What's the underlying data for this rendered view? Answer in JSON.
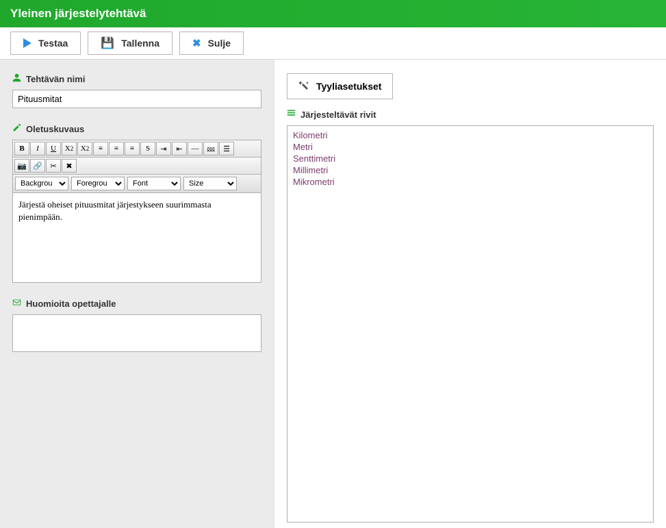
{
  "header": {
    "title": "Yleinen järjestelytehtävä"
  },
  "toolbar": {
    "test": "Testaa",
    "save": "Tallenna",
    "close": "Sulje"
  },
  "left": {
    "name_label": "Tehtävän nimi",
    "name_value": "Pituusmitat",
    "desc_label": "Oletuskuvaus",
    "desc_text": "Järjestä oheiset pituusmitat järjestykseen suurimmasta pienimpään.",
    "notes_label": "Huomioita opettajalle",
    "notes_value": ""
  },
  "rte": {
    "bg": "Backgrou",
    "fg": "Foregrou",
    "font": "Font",
    "size": "Size"
  },
  "right": {
    "style_btn": "Tyyliasetukset",
    "rows_label": "Järjesteltävät rivit",
    "rows": [
      "Kilometri",
      "Metri",
      "Senttimetri",
      "Millimetri",
      "Mikrometri"
    ]
  }
}
